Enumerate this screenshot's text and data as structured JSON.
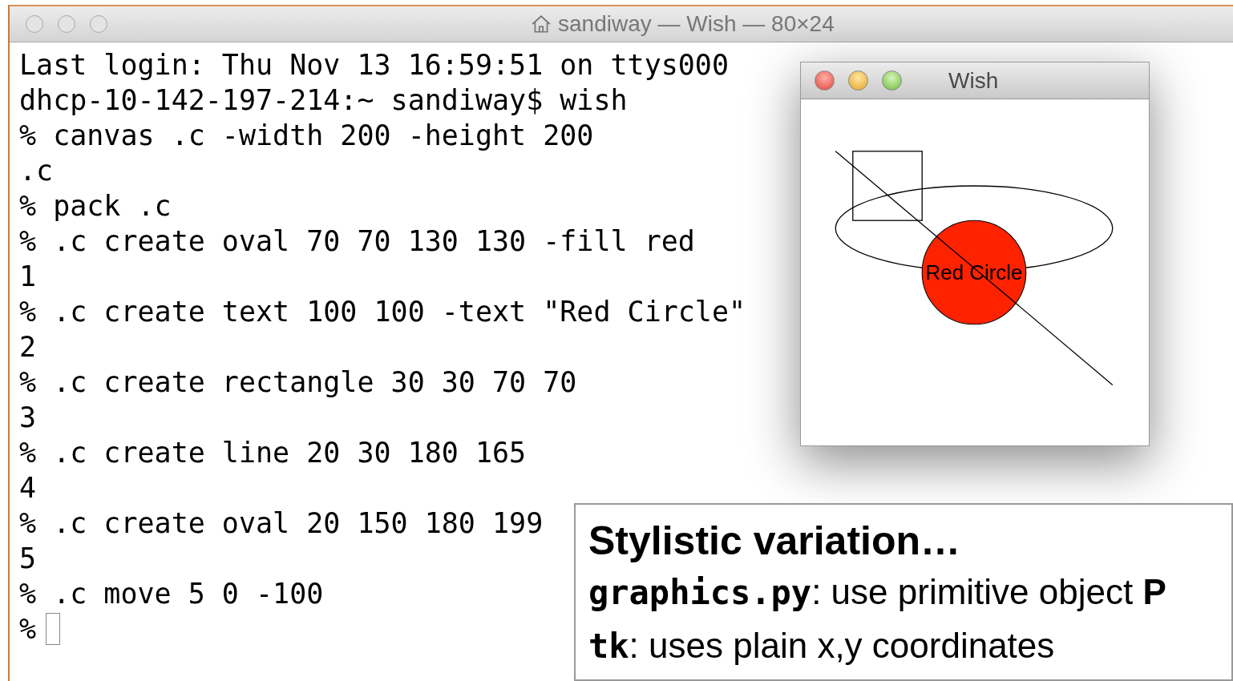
{
  "window": {
    "title": "sandiway — Wish — 80×24"
  },
  "terminal": {
    "lines": [
      "Last login: Thu Nov 13 16:59:51 on ttys000",
      "dhcp-10-142-197-214:~ sandiway$ wish",
      "% canvas .c -width 200 -height 200",
      ".c",
      "% pack .c",
      "% .c create oval 70 70 130 130 -fill red",
      "1",
      "% .c create text 100 100 -text \"Red Circle\"",
      "2",
      "% .c create rectangle 30 30 70 70",
      "3",
      "% .c create line 20 30 180 165",
      "4",
      "% .c create oval 20 150 180 199",
      "5",
      "% .c move 5 0 -100",
      "%"
    ],
    "cursor": true
  },
  "wish_window": {
    "title": "Wish",
    "canvas_text": "Red Circle"
  },
  "note": {
    "title": "Stylistic variation…",
    "lines": [
      {
        "term": "graphics.py",
        "text": ": use primitive object **P**"
      },
      {
        "term": "tk",
        "text": ": uses plain x,y coordinates"
      }
    ]
  }
}
